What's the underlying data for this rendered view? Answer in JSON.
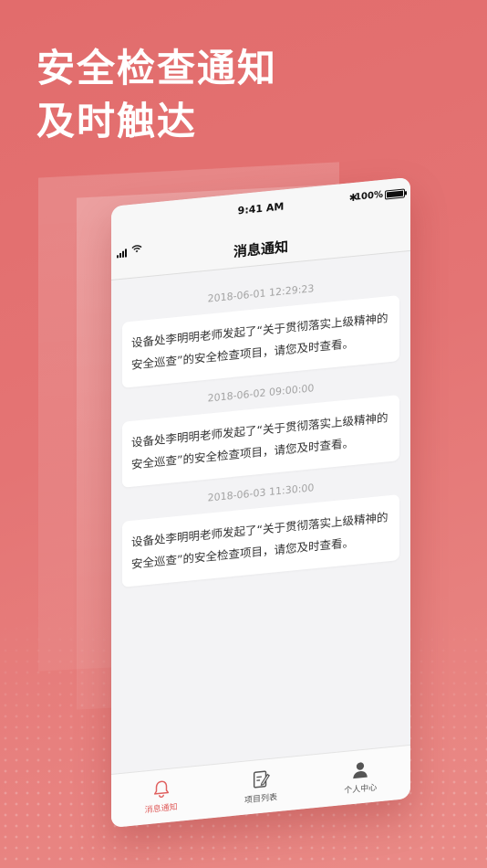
{
  "promo": {
    "line1": "安全检查通知",
    "line2": "及时触达"
  },
  "status_bar": {
    "time": "9:41 AM",
    "battery": "100%"
  },
  "page": {
    "title": "消息通知"
  },
  "messages": [
    {
      "time": "2018-06-01 12:29:23",
      "text": "设备处李明明老师发起了“关于贯彻落实上级精神的安全巡查”的安全检查项目，请您及时查看。"
    },
    {
      "time": "2018-06-02 09:00:00",
      "text": "设备处李明明老师发起了“关于贯彻落实上级精神的安全巡查”的安全检查项目，请您及时查看。"
    },
    {
      "time": "2018-06-03 11:30:00",
      "text": "设备处李明明老师发起了“关于贯彻落实上级精神的安全巡查”的安全检查项目，请您及时查看。"
    }
  ],
  "tabs": [
    {
      "label": "消息通知",
      "icon": "bell-icon",
      "active": true
    },
    {
      "label": "项目列表",
      "icon": "edit-list-icon",
      "active": false
    },
    {
      "label": "个人中心",
      "icon": "user-icon",
      "active": false
    }
  ],
  "colors": {
    "accent": "#e0605f",
    "background": "#e26c6c"
  }
}
